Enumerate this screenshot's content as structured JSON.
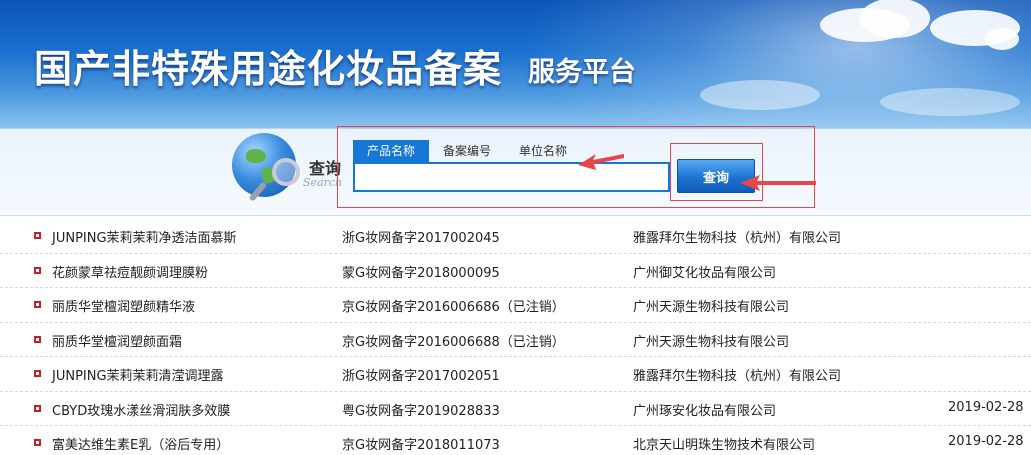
{
  "header": {
    "title": "国产非特殊用途化妆品备案",
    "subtitle": "服务平台"
  },
  "search": {
    "label_cn": "查询",
    "label_en": "Search",
    "tabs": [
      "产品名称",
      "备案编号",
      "单位名称"
    ],
    "active_tab": 0,
    "input_value": "",
    "input_placeholder": "",
    "button_label": "查询"
  },
  "colors": {
    "accent": "#1677d6",
    "annotation_red": "#e8474a",
    "bullet_red": "#c51f2a"
  },
  "results": [
    {
      "name": "JUNPING茉莉茉莉净透洁面慕斯",
      "code": "浙G妆网备字2017002045",
      "company": "雅露拜尔生物科技（杭州）有限公司",
      "date": ""
    },
    {
      "name": "花颜蒙草祛痘靓颜调理膜粉",
      "code": "蒙G妆网备字2018000095",
      "company": "广州御艾化妆品有限公司",
      "date": ""
    },
    {
      "name": "丽质华堂檀润塑颜精华液",
      "code": "京G妆网备字2016006686（已注销）",
      "company": "广州天源生物科技有限公司",
      "date": ""
    },
    {
      "name": "丽质华堂檀润塑颜面霜",
      "code": "京G妆网备字2016006688（已注销）",
      "company": "广州天源生物科技有限公司",
      "date": ""
    },
    {
      "name": "JUNPING茉莉茉莉清滢调理露",
      "code": "浙G妆网备字2017002051",
      "company": "雅露拜尔生物科技（杭州）有限公司",
      "date": ""
    },
    {
      "name": "CBYD玫瑰水漾丝滑润肤多效膜",
      "code": "粤G妆网备字2019028833",
      "company": "广州琢安化妆品有限公司",
      "date": "2019-02-28"
    },
    {
      "name": "富美达维生素E乳（浴后专用）",
      "code": "京G妆网备字2018011073",
      "company": "北京天山明珠生物技术有限公司",
      "date": "2019-02-28"
    }
  ]
}
